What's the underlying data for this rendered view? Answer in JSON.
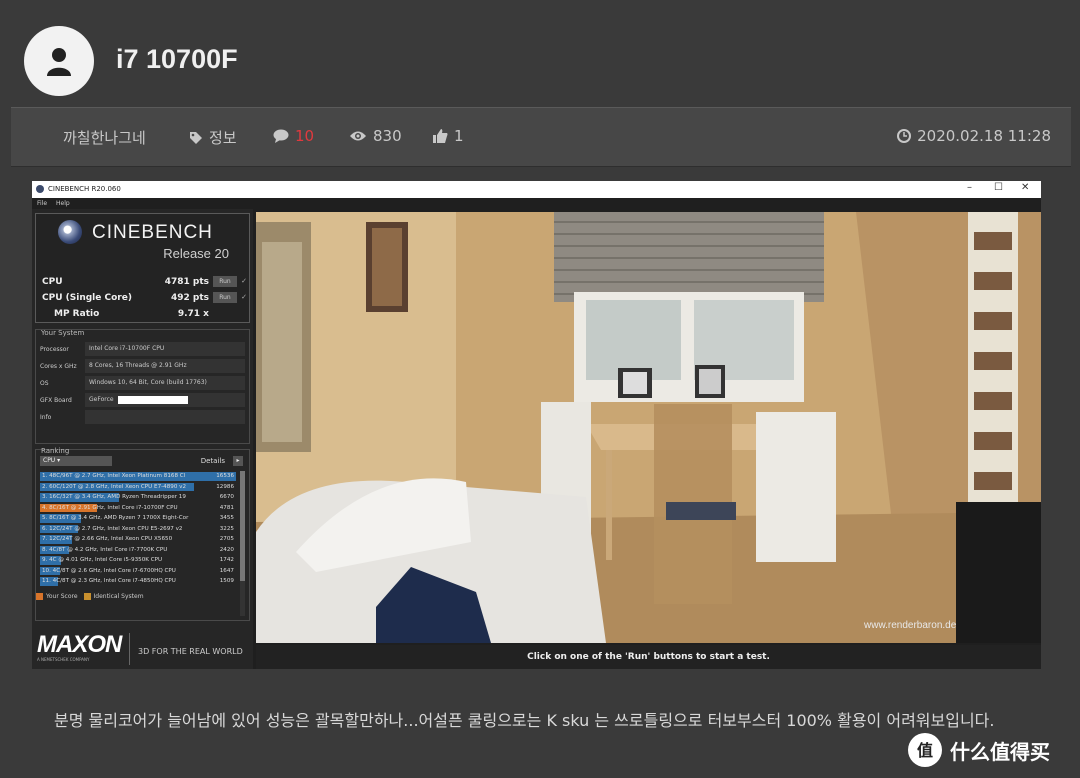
{
  "post": {
    "title": "i7 10700F",
    "author": "까칠한나그네",
    "category": "정보",
    "comments": "10",
    "views": "830",
    "likes": "1",
    "date": "2020.02.18 11:28",
    "body": "분명 물리코어가 늘어남에 있어 성능은 괄목할만하나...어설픈 쿨링으로는 K sku 는 쓰로틀링으로 터보부스터 100% 활용이 어려워보입니다."
  },
  "cinebench": {
    "window_title": "CINEBENCH R20.060",
    "menu": [
      "File",
      "Help"
    ],
    "brand": "CINEBENCH",
    "release": "Release 20",
    "scores": [
      {
        "label": "CPU",
        "value": "4781 pts",
        "run": "Run"
      },
      {
        "label": "CPU (Single Core)",
        "value": "492 pts",
        "run": "Run"
      },
      {
        "label": "MP Ratio",
        "value": "9.71 x"
      }
    ],
    "system_title": "Your System",
    "system": [
      {
        "key": "Processor",
        "value": "Intel Core i7-10700F CPU"
      },
      {
        "key": "Cores x GHz",
        "value": "8 Cores, 16 Threads @ 2.91 GHz"
      },
      {
        "key": "OS",
        "value": "Windows 10, 64 Bit, Core (build 17763)"
      },
      {
        "key": "GFX Board",
        "value": "GeForce"
      },
      {
        "key": "Info",
        "value": ""
      }
    ],
    "ranking_title": "Ranking",
    "ranking_select": "CPU",
    "details_label": "Details",
    "ranking": [
      {
        "text": "1. 48C/96T @ 2.7 GHz, Intel Xeon Platinum 8168 Cl",
        "score": "16536",
        "fill": 1.0
      },
      {
        "text": "2. 60C/120T @ 2.8 GHz, Intel Xeon CPU E7-4890 v2",
        "score": "12986",
        "fill": 0.785
      },
      {
        "text": "3. 16C/32T @ 3.4 GHz, AMD Ryzen Threadripper 19",
        "score": "6670",
        "fill": 0.403
      },
      {
        "text": "4. 8C/16T @ 2.91 GHz, Intel Core i7-10700F CPU",
        "score": "4781",
        "fill": 0.289,
        "you": true
      },
      {
        "text": "5. 8C/16T @ 3.4 GHz, AMD Ryzen 7 1700X Eight-Cor",
        "score": "3455",
        "fill": 0.209
      },
      {
        "text": "6. 12C/24T @ 2.7 GHz, Intel Xeon CPU E5-2697 v2",
        "score": "3225",
        "fill": 0.195
      },
      {
        "text": "7. 12C/24T @ 2.66 GHz, Intel Xeon CPU X5650",
        "score": "2705",
        "fill": 0.164
      },
      {
        "text": "8. 4C/8T @ 4.2 GHz, Intel Core i7-7700K CPU",
        "score": "2420",
        "fill": 0.146
      },
      {
        "text": "9. 4C @ 4.01 GHz, Intel Core i5-9350K CPU",
        "score": "1742",
        "fill": 0.105
      },
      {
        "text": "10. 4C/8T @ 2.6 GHz, Intel Core i7-6700HQ CPU",
        "score": "1647",
        "fill": 0.1
      },
      {
        "text": "11. 4C/8T @ 2.3 GHz, Intel Core i7-4850HQ CPU",
        "score": "1509",
        "fill": 0.091
      }
    ],
    "legend_your": "Your Score",
    "legend_identical": "Identical System",
    "maxon": "MAXON",
    "maxon_sub": "A NEMETSCHEK COMPANY",
    "tagline": "3D FOR THE REAL WORLD",
    "render_credit": "www.renderbaron.de",
    "status": "Click on one of the 'Run' buttons to start a test."
  },
  "watermark": "什么值得买"
}
